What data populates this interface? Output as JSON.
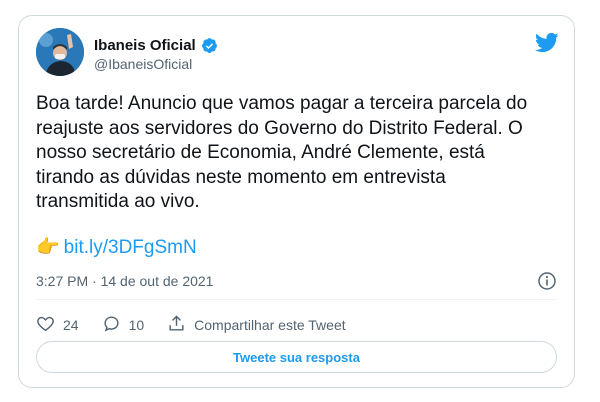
{
  "author": {
    "name": "Ibaneis Oficial",
    "handle": "@IbaneisOficial",
    "verified": true
  },
  "tweet": {
    "text": "Boa tarde! Anuncio que vamos pagar a terceira parcela do\nreajuste aos servidores do Governo do Distrito Federal. O\nnosso secretário de Economia, André Clemente, está\ntirando as dúvidas neste momento em entrevista\ntransmitida ao vivo.",
    "link_emoji": "👉",
    "link": "bit.ly/3DFgSmN",
    "timestamp": "3:27 PM · 14 de out de 2021"
  },
  "actions": {
    "likes": "24",
    "replies": "10",
    "share_label": "Compartilhar este Tweet"
  },
  "reply_button": {
    "label": "Tweete sua resposta"
  },
  "colors": {
    "accent": "#1d9bf0",
    "text": "#0f1419",
    "secondary": "#536471",
    "border": "#cfd9de"
  },
  "icons": [
    "twitter-bird-icon",
    "verified-badge-icon",
    "info-icon",
    "heart-icon",
    "reply-bubble-icon",
    "share-icon",
    "pointing-right-icon"
  ]
}
